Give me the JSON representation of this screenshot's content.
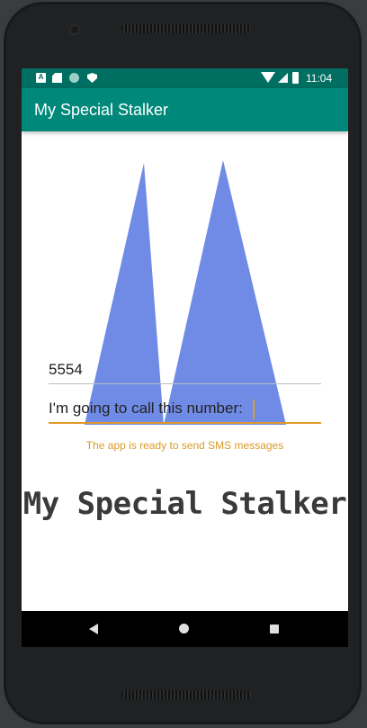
{
  "status_bar": {
    "time": "11:04",
    "icons": [
      "a-notification-icon",
      "sd-card-icon",
      "sync-circle-icon",
      "shield-icon",
      "wifi-icon",
      "signal-icon",
      "battery-icon"
    ]
  },
  "app_bar": {
    "title": "My Special Stalker"
  },
  "form": {
    "phone_number_value": "5554",
    "message_value": "I'm going to call this number:"
  },
  "status_message": "The app is ready to send SMS messages",
  "banner_title": "My Special Stalker",
  "nav_bar": {
    "buttons": [
      "back-icon",
      "home-icon",
      "recents-icon"
    ]
  },
  "colors": {
    "status_bar": "#006e60",
    "app_bar": "#00897b",
    "accent": "#e09a2a",
    "logo_fill": "#6f8be6"
  }
}
